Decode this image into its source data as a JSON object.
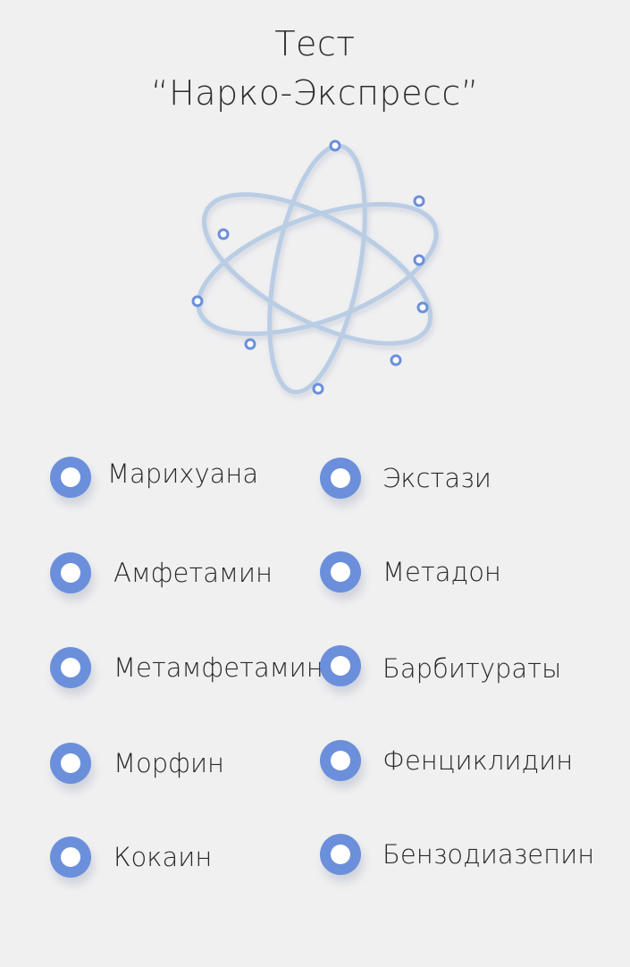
{
  "header": {
    "title_line1": "Тест",
    "title_line2": "“Нарко-Экспресс”"
  },
  "graphic": {
    "icon": "atom-icon",
    "orbit_color": "#b8cde6",
    "node_color": "#6b8fdb"
  },
  "options": {
    "left": [
      {
        "label": "Марихуана"
      },
      {
        "label": "Амфетамин"
      },
      {
        "label": "Метамфетамин"
      },
      {
        "label": "Морфин"
      },
      {
        "label": "Кокаин"
      }
    ],
    "right": [
      {
        "label": "Экстази"
      },
      {
        "label": "Метадон"
      },
      {
        "label": "Барбитураты"
      },
      {
        "label": "Фенциклидин"
      },
      {
        "label": "Бензодиазепин"
      }
    ]
  },
  "colors": {
    "accent": "#6b8fdb",
    "background": "#f0f0f1",
    "text": "#2b2b2b"
  }
}
